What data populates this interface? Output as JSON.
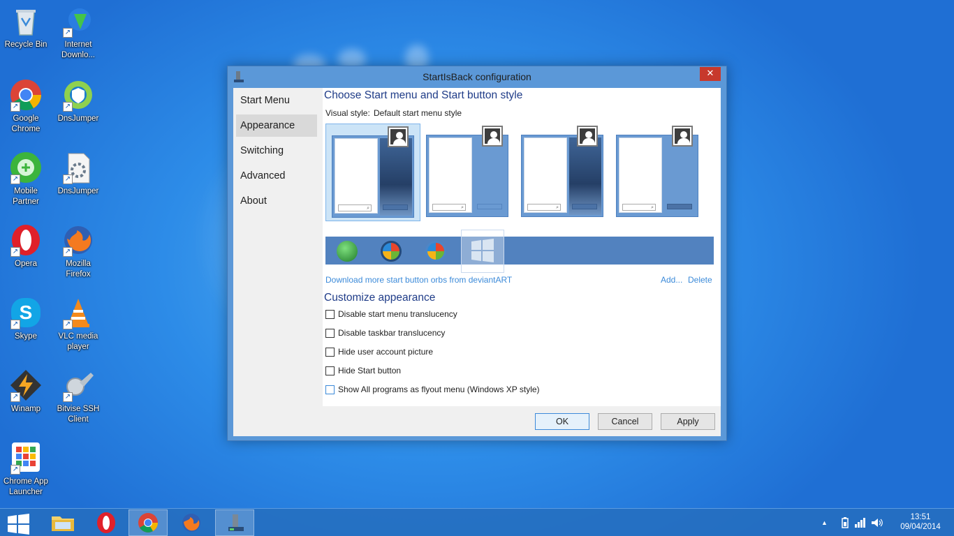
{
  "desktop": {
    "icons": [
      {
        "label_1": "Recycle Bin",
        "label_2": ""
      },
      {
        "label_1": "Internet",
        "label_2": "Downlo..."
      },
      {
        "label_1": "Google",
        "label_2": "Chrome"
      },
      {
        "label_1": "DnsJumper",
        "label_2": ""
      },
      {
        "label_1": "Mobile",
        "label_2": "Partner"
      },
      {
        "label_1": "DnsJumper",
        "label_2": ""
      },
      {
        "label_1": "Opera",
        "label_2": ""
      },
      {
        "label_1": "Mozilla",
        "label_2": "Firefox"
      },
      {
        "label_1": "Skype",
        "label_2": ""
      },
      {
        "label_1": "VLC media",
        "label_2": "player"
      },
      {
        "label_1": "Winamp",
        "label_2": ""
      },
      {
        "label_1": "Bitvise SSH",
        "label_2": "Client"
      },
      {
        "label_1": "Chrome App",
        "label_2": "Launcher"
      }
    ]
  },
  "window": {
    "title": "StartIsBack configuration",
    "close_glyph": "✕",
    "nav": [
      "Start Menu",
      "Appearance",
      "Switching",
      "Advanced",
      "About"
    ],
    "selected_nav": "Appearance",
    "heading": "Choose Start menu and Start button style",
    "visual_style_label": "Visual style:",
    "visual_style_value": "Default start menu style",
    "search_glyph": "⌕",
    "download_link": "Download more start button orbs from deviantART",
    "add_link": "Add...",
    "delete_link": "Delete",
    "customize_heading": "Customize appearance",
    "options": [
      {
        "label": "Disable start menu translucency",
        "checked": false
      },
      {
        "label": "Disable taskbar translucency",
        "checked": false
      },
      {
        "label": "Hide user account picture",
        "checked": false
      },
      {
        "label": "Hide Start button",
        "checked": false
      },
      {
        "label": "Show All programs as flyout menu (Windows XP style)",
        "checked": false
      }
    ],
    "buttons": {
      "ok": "OK",
      "cancel": "Cancel",
      "apply": "Apply"
    }
  },
  "taskbar": {
    "clock_time": "13:51",
    "clock_date": "09/04/2014",
    "tray_arrow": "▲"
  },
  "colors": {
    "accent": "#3c8ad9",
    "heading": "#1f3c88",
    "close": "#c7392c"
  }
}
